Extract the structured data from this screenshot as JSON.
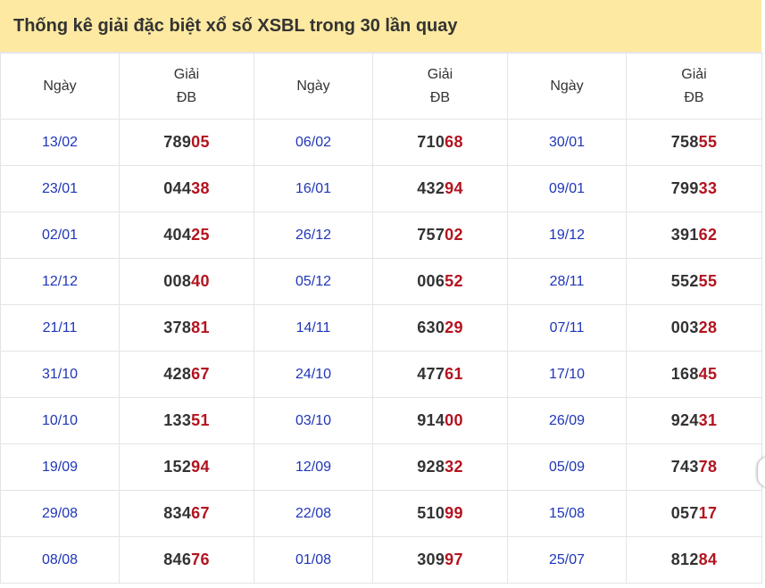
{
  "title": "Thống kê giải đặc biệt xổ số XSBL trong 30 lần quay",
  "headers": {
    "date": "Ngày",
    "prize_line1": "Giải",
    "prize_line2": "ĐB"
  },
  "rows": [
    [
      {
        "date": "13/02",
        "head": "789",
        "tail": "05"
      },
      {
        "date": "06/02",
        "head": "710",
        "tail": "68"
      },
      {
        "date": "30/01",
        "head": "758",
        "tail": "55"
      }
    ],
    [
      {
        "date": "23/01",
        "head": "044",
        "tail": "38"
      },
      {
        "date": "16/01",
        "head": "432",
        "tail": "94"
      },
      {
        "date": "09/01",
        "head": "799",
        "tail": "33"
      }
    ],
    [
      {
        "date": "02/01",
        "head": "404",
        "tail": "25"
      },
      {
        "date": "26/12",
        "head": "757",
        "tail": "02"
      },
      {
        "date": "19/12",
        "head": "391",
        "tail": "62"
      }
    ],
    [
      {
        "date": "12/12",
        "head": "008",
        "tail": "40"
      },
      {
        "date": "05/12",
        "head": "006",
        "tail": "52"
      },
      {
        "date": "28/11",
        "head": "552",
        "tail": "55"
      }
    ],
    [
      {
        "date": "21/11",
        "head": "378",
        "tail": "81"
      },
      {
        "date": "14/11",
        "head": "630",
        "tail": "29"
      },
      {
        "date": "07/11",
        "head": "003",
        "tail": "28"
      }
    ],
    [
      {
        "date": "31/10",
        "head": "428",
        "tail": "67"
      },
      {
        "date": "24/10",
        "head": "477",
        "tail": "61"
      },
      {
        "date": "17/10",
        "head": "168",
        "tail": "45"
      }
    ],
    [
      {
        "date": "10/10",
        "head": "133",
        "tail": "51"
      },
      {
        "date": "03/10",
        "head": "914",
        "tail": "00"
      },
      {
        "date": "26/09",
        "head": "924",
        "tail": "31"
      }
    ],
    [
      {
        "date": "19/09",
        "head": "152",
        "tail": "94"
      },
      {
        "date": "12/09",
        "head": "928",
        "tail": "32"
      },
      {
        "date": "05/09",
        "head": "743",
        "tail": "78"
      }
    ],
    [
      {
        "date": "29/08",
        "head": "834",
        "tail": "67"
      },
      {
        "date": "22/08",
        "head": "510",
        "tail": "99"
      },
      {
        "date": "15/08",
        "head": "057",
        "tail": "17"
      }
    ],
    [
      {
        "date": "08/08",
        "head": "846",
        "tail": "76"
      },
      {
        "date": "01/08",
        "head": "309",
        "tail": "97"
      },
      {
        "date": "25/07",
        "head": "812",
        "tail": "84"
      }
    ]
  ],
  "colors": {
    "title_bg": "#fde9a1",
    "date_text": "#1f36b8",
    "number_text": "#333333",
    "number_tail": "#b3141f",
    "grid": "#e4e4e4"
  }
}
